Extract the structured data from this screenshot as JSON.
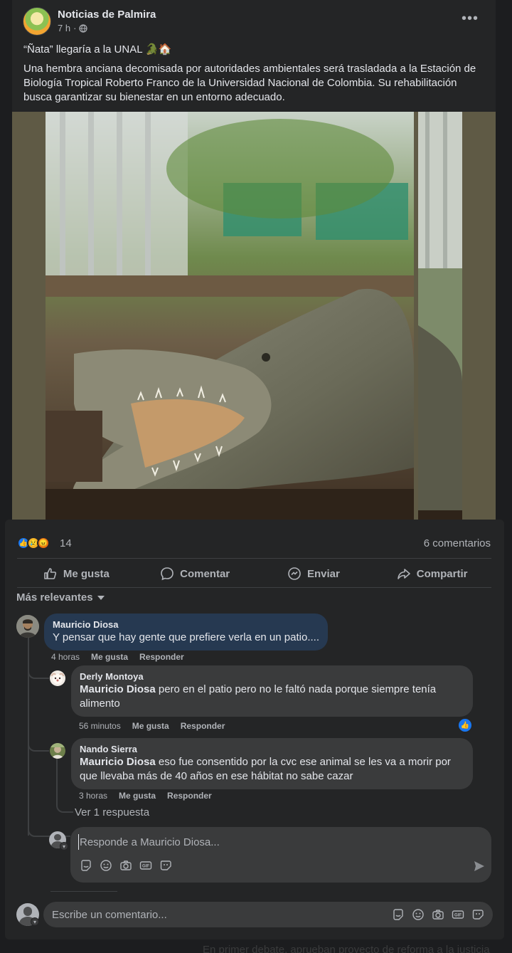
{
  "post": {
    "page_name": "Noticias de Palmira",
    "time": "7 h",
    "audience_icon": "globe-icon",
    "title": "“Ñata” llegaría a la UNAL 🐊🏠",
    "body": "Una hembra anciana decomisada por autoridades ambientales será trasladada a la Estación de Biología Tropical Roberto Franco de la Universidad Nacional de Colombia. Su rehabilitación busca garantizar su bienestar en un entorno adecuado.",
    "photo_label": "crocodile-photo"
  },
  "stats": {
    "reaction_icons": [
      "like-icon",
      "sad-icon",
      "angry-icon"
    ],
    "reaction_count": "14",
    "comment_count": "6 comentarios"
  },
  "actions": {
    "like": "Me gusta",
    "comment": "Comentar",
    "send": "Enviar",
    "share": "Compartir"
  },
  "sort_label": "Más relevantes",
  "comments": [
    {
      "author": "Mauricio Diosa",
      "text": "Y pensar que hay gente que prefiere verla en un patio....",
      "time": "4 horas",
      "like": "Me gusta",
      "reply": "Responder"
    }
  ],
  "replies": [
    {
      "author": "Derly Montoya",
      "mention": "Mauricio Diosa",
      "text": " pero en el patio pero no le faltó nada porque siempre tenía alimento",
      "time": "56 minutos",
      "like": "Me gusta",
      "reply": "Responder",
      "has_like_reaction": true
    },
    {
      "author": "Nando Sierra",
      "mention": "Mauricio Diosa",
      "text": " eso fue consentido por la cvc ese animal se les va a morir por que llevaba más de 40 años en ese hábitat no sabe cazar",
      "time": "3 horas",
      "like": "Me gusta",
      "reply": "Responder"
    }
  ],
  "more_replies": "Ver 1 respuesta",
  "reply_box": {
    "placeholder": "Responde a Mauricio Diosa..."
  },
  "comment_box": {
    "placeholder": "Escribe un comentario..."
  },
  "tools": [
    "sticker-icon",
    "emoji-icon",
    "camera-icon",
    "gif-icon",
    "avatar-sticker-icon"
  ],
  "background_headline": "En primer debate, aprueban proyecto de reforma a la justicia",
  "colors": {
    "surface": "#242526",
    "input": "#3a3b3c",
    "highlight_bubble": "#263951",
    "accent": "#1877f2",
    "text": "#e4e6eb",
    "muted": "#b0b3b8"
  }
}
